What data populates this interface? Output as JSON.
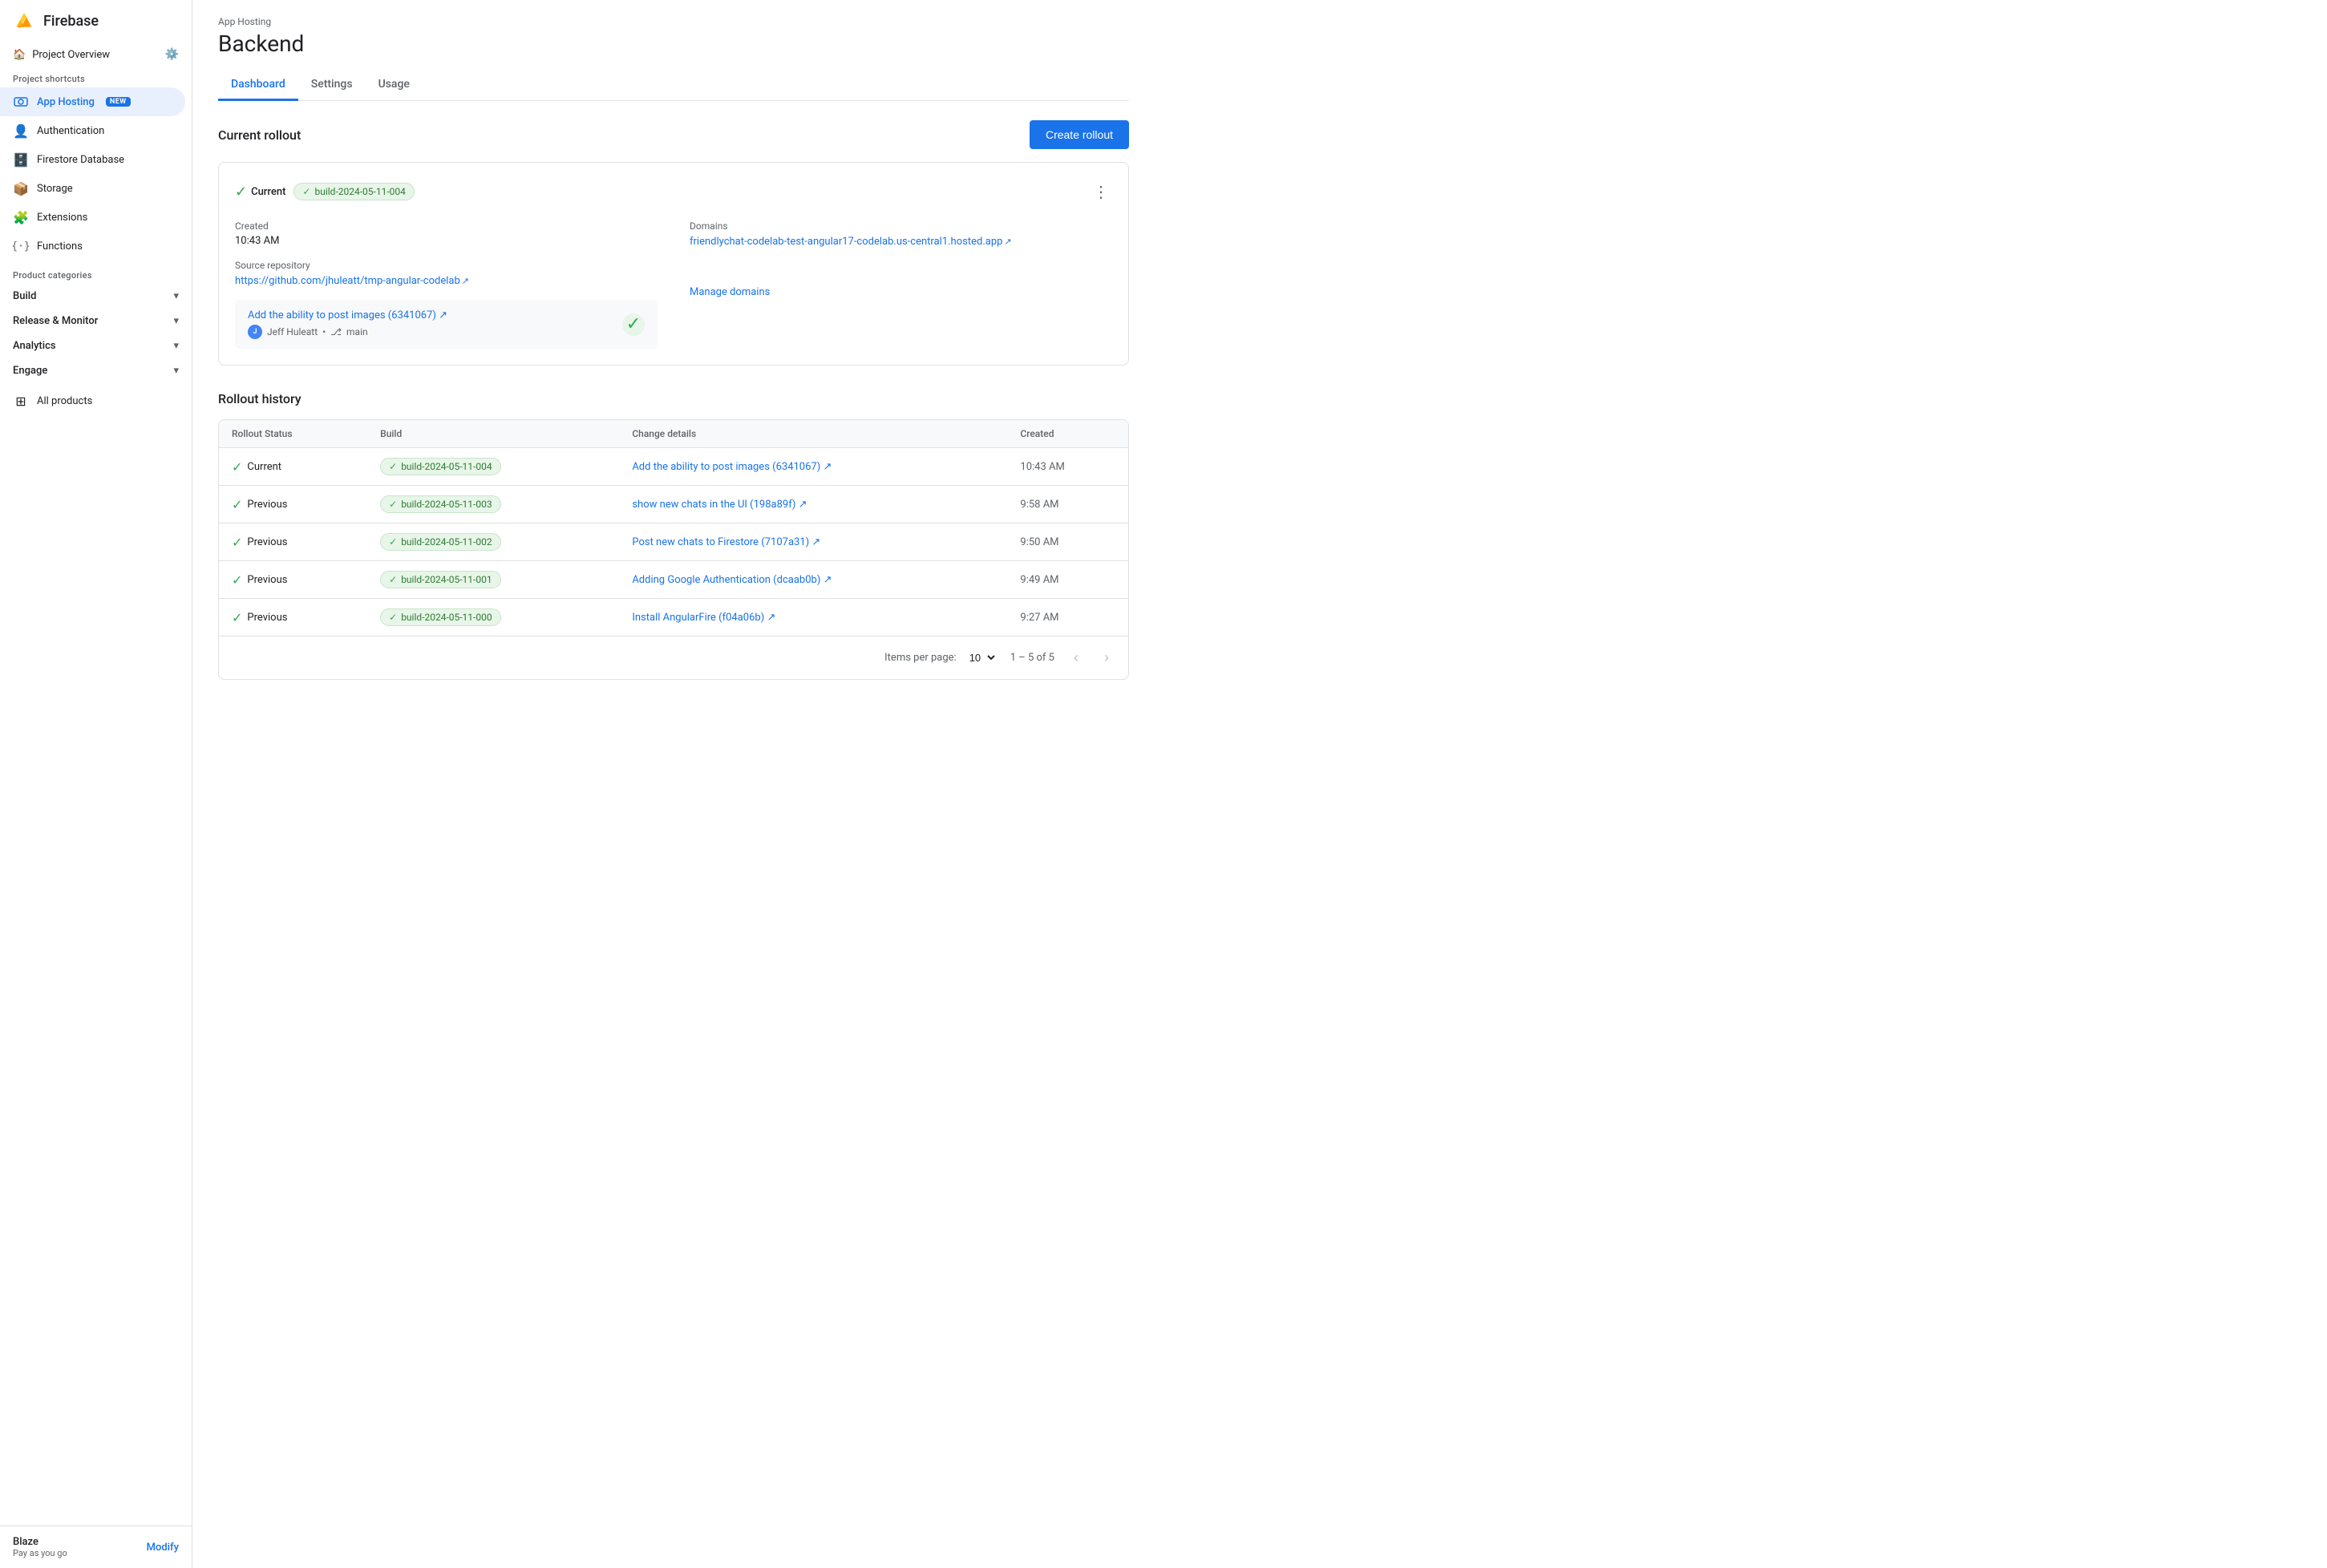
{
  "sidebar": {
    "app_name": "Firebase",
    "project_overview_label": "Project Overview",
    "project_shortcuts_label": "Project shortcuts",
    "product_categories_label": "Product categories",
    "items": [
      {
        "id": "app-hosting",
        "label": "App Hosting",
        "badge": "NEW",
        "active": true
      },
      {
        "id": "authentication",
        "label": "Authentication",
        "active": false
      },
      {
        "id": "firestore",
        "label": "Firestore Database",
        "active": false
      },
      {
        "id": "storage",
        "label": "Storage",
        "active": false
      },
      {
        "id": "extensions",
        "label": "Extensions",
        "active": false
      },
      {
        "id": "functions",
        "label": "Functions",
        "active": false
      }
    ],
    "categories": [
      {
        "id": "build",
        "label": "Build"
      },
      {
        "id": "release-monitor",
        "label": "Release & Monitor"
      },
      {
        "id": "analytics",
        "label": "Analytics"
      },
      {
        "id": "engage",
        "label": "Engage"
      }
    ],
    "all_products_label": "All products",
    "footer": {
      "plan_name": "Blaze",
      "plan_sub": "Pay as you go",
      "modify_label": "Modify"
    }
  },
  "header": {
    "breadcrumb": "App Hosting",
    "title": "Backend"
  },
  "tabs": [
    {
      "id": "dashboard",
      "label": "Dashboard",
      "active": true
    },
    {
      "id": "settings",
      "label": "Settings",
      "active": false
    },
    {
      "id": "usage",
      "label": "Usage",
      "active": false
    }
  ],
  "current_rollout": {
    "section_title": "Current rollout",
    "create_btn_label": "Create rollout",
    "status": "Current",
    "build_tag": "build-2024-05-11-004",
    "created_label": "Created",
    "created_time": "10:43 AM",
    "source_repo_label": "Source repository",
    "source_repo_url": "https://github.com/jhuleatt/tmp-angular-codelab",
    "source_repo_display": "https://github.com/jhuleatt/tmp-angular-codelab ↗",
    "domains_label": "Domains",
    "domains_url": "friendlychat-codelab-test-angular17-codelab.us-central1.hosted.app",
    "domains_display": "friendlychat-codelab-test-angular17-codelab.us-central1.hosted.app ↗",
    "commit_title": "Add the ability to post images (6341067) ↗",
    "commit_author": "Jeff Huleatt",
    "commit_branch": "main",
    "manage_domains_label": "Manage domains"
  },
  "rollout_history": {
    "section_title": "Rollout history",
    "columns": [
      "Rollout Status",
      "Build",
      "Change details",
      "Created"
    ],
    "rows": [
      {
        "status": "Current",
        "build": "build-2024-05-11-004",
        "change": "Add the ability to post images (6341067) ↗",
        "created": "10:43 AM"
      },
      {
        "status": "Previous",
        "build": "build-2024-05-11-003",
        "change": "show new chats in the UI (198a89f) ↗",
        "created": "9:58 AM"
      },
      {
        "status": "Previous",
        "build": "build-2024-05-11-002",
        "change": "Post new chats to Firestore (7107a31) ↗",
        "created": "9:50 AM"
      },
      {
        "status": "Previous",
        "build": "build-2024-05-11-001",
        "change": "Adding Google Authentication (dcaab0b) ↗",
        "created": "9:49 AM"
      },
      {
        "status": "Previous",
        "build": "build-2024-05-11-000",
        "change": "Install AngularFire (f04a06b) ↗",
        "created": "9:27 AM"
      }
    ],
    "items_per_page_label": "Items per page:",
    "items_per_page_value": "10",
    "pagination_info": "1 – 5 of 5"
  }
}
